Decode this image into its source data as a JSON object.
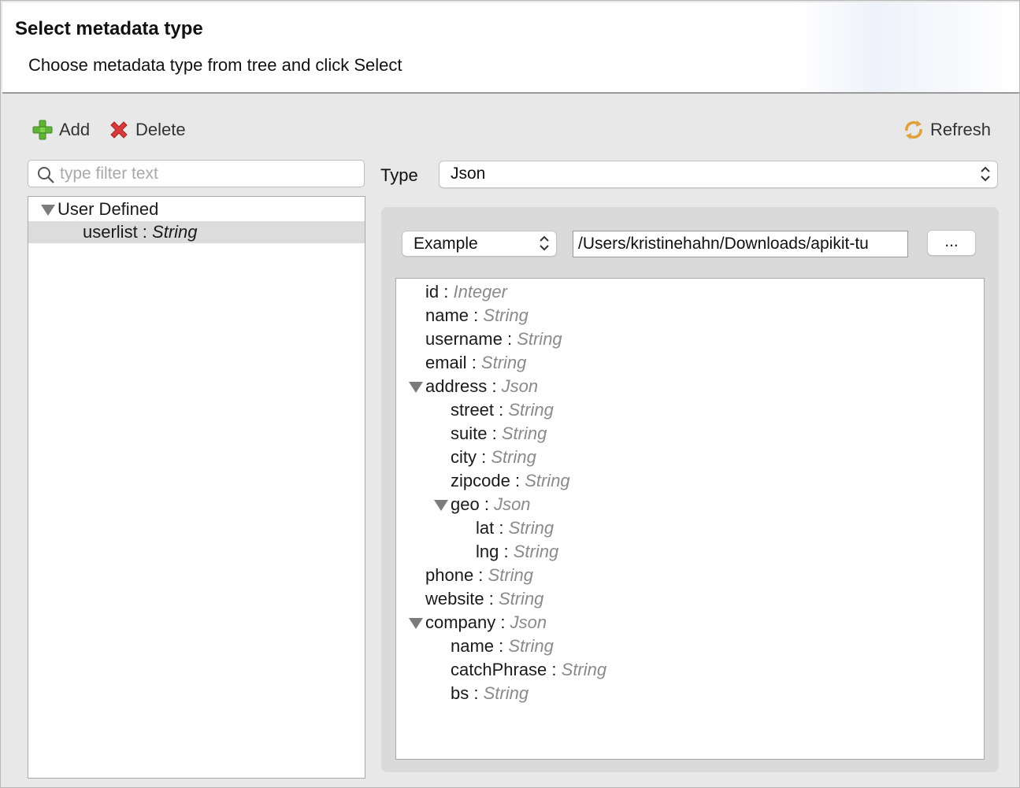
{
  "header": {
    "title": "Select metadata type",
    "subtitle": "Choose metadata type from tree and click Select"
  },
  "toolbar": {
    "add_label": "Add",
    "delete_label": "Delete",
    "refresh_label": "Refresh"
  },
  "filter": {
    "placeholder": "type filter text",
    "value": ""
  },
  "left_tree": {
    "group_label": "User Defined",
    "item_name": "userlist",
    "item_separator": " : ",
    "item_type": "String"
  },
  "type_field": {
    "label": "Type",
    "value": "Json"
  },
  "source": {
    "mode": "Example",
    "path": "/Users/kristinehahn/Downloads/apikit-tu",
    "browse_label": "..."
  },
  "right_tree": [
    {
      "name": "id",
      "type": "Integer",
      "expandable": false
    },
    {
      "name": "name",
      "type": "String",
      "expandable": false
    },
    {
      "name": "username",
      "type": "String",
      "expandable": false
    },
    {
      "name": "email",
      "type": "String",
      "expandable": false
    },
    {
      "name": "address",
      "type": "Json",
      "expandable": true
    },
    {
      "name": "street",
      "type": "String",
      "expandable": false
    },
    {
      "name": "suite",
      "type": "String",
      "expandable": false
    },
    {
      "name": "city",
      "type": "String",
      "expandable": false
    },
    {
      "name": "zipcode",
      "type": "String",
      "expandable": false
    },
    {
      "name": "geo",
      "type": "Json",
      "expandable": true
    },
    {
      "name": "lat",
      "type": "String",
      "expandable": false
    },
    {
      "name": "lng",
      "type": "String",
      "expandable": false
    },
    {
      "name": "phone",
      "type": "String",
      "expandable": false
    },
    {
      "name": "website",
      "type": "String",
      "expandable": false
    },
    {
      "name": "company",
      "type": "Json",
      "expandable": true
    },
    {
      "name": "name",
      "type": "String",
      "expandable": false
    },
    {
      "name": "catchPhrase",
      "type": "String",
      "expandable": false
    },
    {
      "name": "bs",
      "type": "String",
      "expandable": false
    }
  ],
  "icons": {
    "add": "plus-icon",
    "delete": "delete-x-icon",
    "refresh": "refresh-icon",
    "search": "search-icon",
    "expand": "expand-triangle-icon",
    "select": "updown-chevron-icon"
  },
  "colors": {
    "add_green": "#5fb336",
    "delete_red": "#d83a3a",
    "refresh_orange": "#e1a13a",
    "selection_gray": "#dcdcdc",
    "type_gray": "#8a8a8a"
  }
}
